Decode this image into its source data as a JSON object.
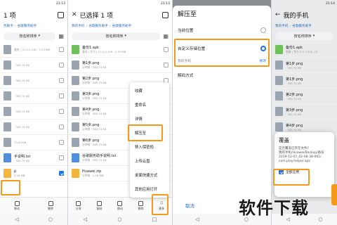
{
  "panel1": {
    "time": "21:13",
    "title": "1 项",
    "breadcrumb": [
      "务助手",
      "谷歌服务助手"
    ],
    "sort_label": "按名称排序",
    "files": [
      {
        "name": "",
        "meta": "备份 | 11.0.0.149 · 2.53 MB"
      },
      {
        "name": "",
        "meta": "· 385.74 KB"
      },
      {
        "name": "",
        "meta": "· 385.74 KB"
      },
      {
        "name": "",
        "meta": "· 385.74 KB"
      },
      {
        "name": "",
        "meta": "· 385.74 KB"
      },
      {
        "name": "",
        "meta": "· 385.74 KB"
      },
      {
        "name": "",
        "meta": "73.03 KB"
      },
      {
        "name": "手说明.txt",
        "meta": "· 385.74 KB"
      },
      {
        "name": "p",
        "meta": "4.26 MB"
      }
    ],
    "bottom": [
      "移动",
      "删除"
    ]
  },
  "panel2": {
    "time": "21:13",
    "title": "已选择 1 项",
    "breadcrumb": [
      "我的手机",
      "谷歌服务助手",
      "谷歌服务助手"
    ],
    "sort_label": "按名称排序",
    "files": [
      {
        "name": "备份1.apk",
        "meta": "备份 | 华为 | 11.0.0.149 · 2.53 MB"
      },
      {
        "name": "第1步.png",
        "meta": "分钟前 · 385.74 KB"
      },
      {
        "name": "第2步.png",
        "meta": "分钟前 · 385.74 KB"
      },
      {
        "name": "第3步.png",
        "meta": "分钟前 · 385.74 KB"
      },
      {
        "name": "第4步.png",
        "meta": "分钟前 · 385.74 KB"
      },
      {
        "name": "第5步.png",
        "meta": "分钟前 · 385.74 KB"
      },
      {
        "name": "第6步.png",
        "meta": "分钟前 · 385.74 KB"
      },
      {
        "name": "谷歌服务助手说明.txt",
        "meta": "分钟前 · 385.74 KB"
      },
      {
        "name": "Huawei.zip",
        "meta": "分钟前 · 4.26 MB"
      }
    ],
    "menu": [
      "收藏",
      "重命名",
      "详情",
      "解压至",
      "移入保密柜",
      "上传云盘",
      "桌面快捷方式",
      "其他应用打开"
    ],
    "bottom": [
      "分享",
      "复制",
      "移动",
      "删除",
      "更多"
    ]
  },
  "panel3": {
    "title": "解压至",
    "opt_current": "当前位置",
    "opt_custom": "自定义存储位置",
    "path_label": "我的手机",
    "modify": "修改",
    "decode": "解码方式",
    "cancel": "取消"
  },
  "panel4": {
    "time": "21:14",
    "title": "我的手机",
    "breadcrumb": [
      "我的手机",
      "谷歌服务助手"
    ],
    "sort_label": "按名称排序",
    "files": [
      {
        "name": "备份1.apk",
        "meta": "相册 | 华为 9.5.3.305_C0"
      },
      {
        "name": "第1步.png",
        "meta": "· 385.74 KB"
      },
      {
        "name": "第1步.png",
        "meta": "· 385.74 KB"
      },
      {
        "name": "第2步.png",
        "meta": "· 385.74 KB"
      },
      {
        "name": "第3步.png",
        "meta": "· 385.74 KB"
      },
      {
        "name": "第4步.png",
        "meta": "· 385.74 KB"
      }
    ],
    "dialog": {
      "title": "覆盖",
      "lines": [
        "是否覆盖已存在文件?",
        "我的手机/Huawei/Backup/备份",
        "2019-12-07_02-08-38-061/",
        "com.play.helper.apk"
      ],
      "apply_all": "全部应用"
    }
  },
  "watermark": "软件下载"
}
